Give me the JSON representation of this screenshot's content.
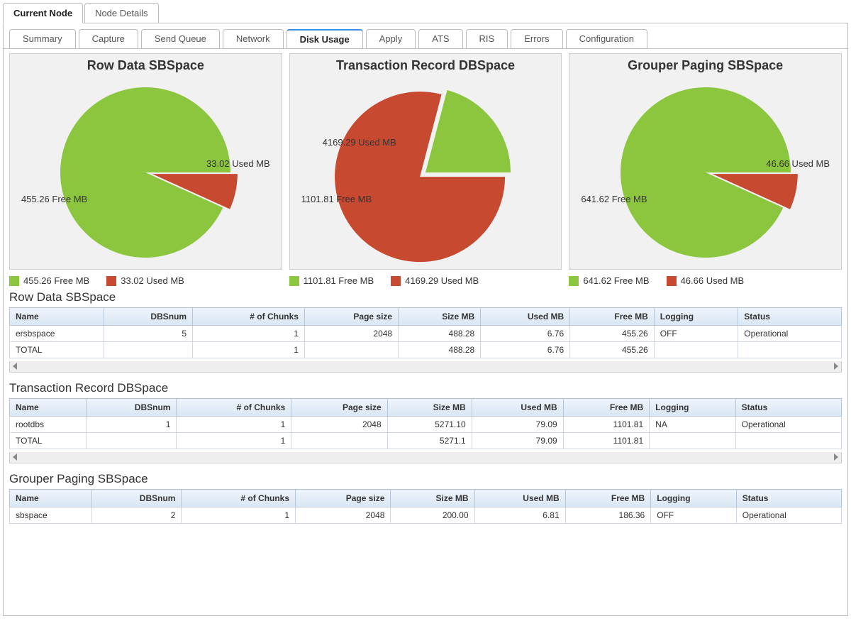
{
  "outerTabs": [
    {
      "label": "Current Node",
      "active": true
    },
    {
      "label": "Node Details",
      "active": false
    }
  ],
  "innerTabs": [
    {
      "label": "Summary"
    },
    {
      "label": "Capture"
    },
    {
      "label": "Send Queue"
    },
    {
      "label": "Network"
    },
    {
      "label": "Disk Usage",
      "active": true
    },
    {
      "label": "Apply"
    },
    {
      "label": "ATS"
    },
    {
      "label": "RIS"
    },
    {
      "label": "Errors"
    },
    {
      "label": "Configuration"
    }
  ],
  "colors": {
    "free": "#8cc63f",
    "used": "#c7492f"
  },
  "charts": [
    {
      "title": "Row Data SBSpace",
      "free": {
        "value": 455.26,
        "label": "455.26 Free MB"
      },
      "used": {
        "value": 33.02,
        "label": "33.02 Used MB"
      }
    },
    {
      "title": "Transaction Record DBSpace",
      "free": {
        "value": 1101.81,
        "label": "1101.81 Free MB"
      },
      "used": {
        "value": 4169.29,
        "label": "4169.29 Used MB"
      }
    },
    {
      "title": "Grouper Paging SBSpace",
      "free": {
        "value": 641.62,
        "label": "641.62 Free MB"
      },
      "used": {
        "value": 46.66,
        "label": "46.66 Used MB"
      }
    }
  ],
  "tableHeaders": [
    "Name",
    "DBSnum",
    "# of Chunks",
    "Page size",
    "Size MB",
    "Used MB",
    "Free MB",
    "Logging",
    "Status"
  ],
  "sections": [
    {
      "title": "Row Data SBSpace",
      "rows": [
        {
          "Name": "ersbspace",
          "DBSnum": "5",
          "Chunks": "1",
          "PageSize": "2048",
          "SizeMB": "488.28",
          "UsedMB": "6.76",
          "FreeMB": "455.26",
          "Logging": "OFF",
          "Status": "Operational"
        },
        {
          "Name": "TOTAL",
          "DBSnum": "",
          "Chunks": "1",
          "PageSize": "",
          "SizeMB": "488.28",
          "UsedMB": "6.76",
          "FreeMB": "455.26",
          "Logging": "",
          "Status": ""
        }
      ]
    },
    {
      "title": "Transaction Record DBSpace",
      "rows": [
        {
          "Name": "rootdbs",
          "DBSnum": "1",
          "Chunks": "1",
          "PageSize": "2048",
          "SizeMB": "5271.10",
          "UsedMB": "79.09",
          "FreeMB": "1101.81",
          "Logging": "NA",
          "Status": "Operational"
        },
        {
          "Name": "TOTAL",
          "DBSnum": "",
          "Chunks": "1",
          "PageSize": "",
          "SizeMB": "5271.1",
          "UsedMB": "79.09",
          "FreeMB": "1101.81",
          "Logging": "",
          "Status": ""
        }
      ]
    },
    {
      "title": "Grouper Paging SBSpace",
      "rows": [
        {
          "Name": "sbspace",
          "DBSnum": "2",
          "Chunks": "1",
          "PageSize": "2048",
          "SizeMB": "200.00",
          "UsedMB": "6.81",
          "FreeMB": "186.36",
          "Logging": "OFF",
          "Status": "Operational"
        }
      ]
    }
  ],
  "chart_data": [
    {
      "type": "pie",
      "title": "Row Data SBSpace",
      "series": [
        {
          "name": "Free MB",
          "value": 455.26
        },
        {
          "name": "Used MB",
          "value": 33.02
        }
      ]
    },
    {
      "type": "pie",
      "title": "Transaction Record DBSpace",
      "series": [
        {
          "name": "Free MB",
          "value": 1101.81
        },
        {
          "name": "Used MB",
          "value": 4169.29
        }
      ]
    },
    {
      "type": "pie",
      "title": "Grouper Paging SBSpace",
      "series": [
        {
          "name": "Free MB",
          "value": 641.62
        },
        {
          "name": "Used MB",
          "value": 46.66
        }
      ]
    }
  ]
}
